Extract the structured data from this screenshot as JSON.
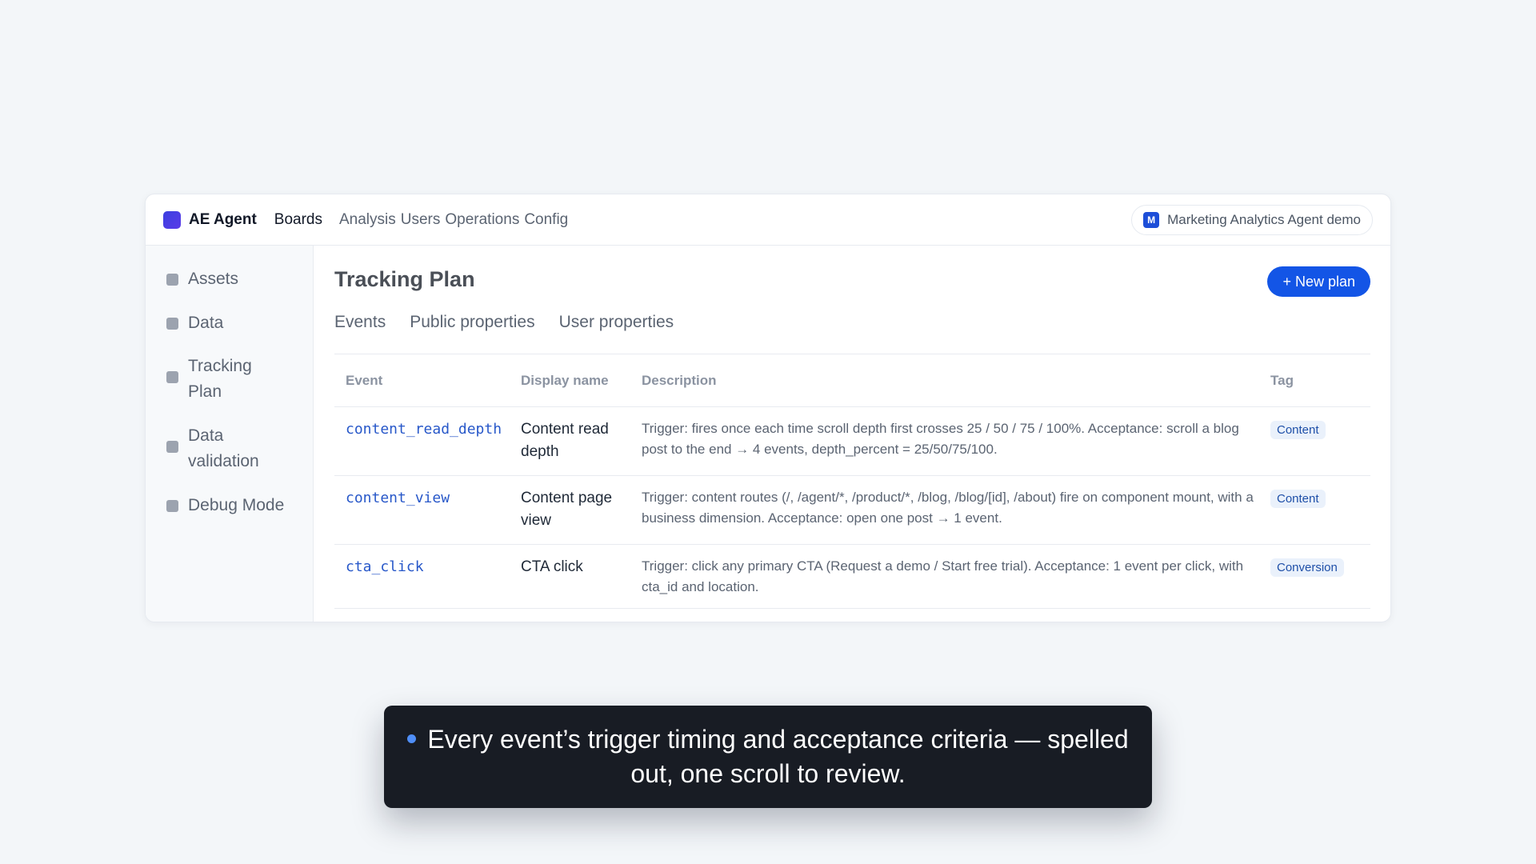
{
  "topbar": {
    "brand": "AE Agent",
    "nav_boards": "Boards",
    "nav_links": [
      "Analysis",
      "Users",
      "Operations",
      "Config"
    ],
    "workspace_badge": "M",
    "workspace_name": "Marketing Analytics Agent demo"
  },
  "sidebar": {
    "items": [
      {
        "label": "Assets"
      },
      {
        "label": "Data"
      },
      {
        "label": "Tracking Plan"
      },
      {
        "label": "Data validation"
      },
      {
        "label": "Debug Mode"
      }
    ]
  },
  "main": {
    "title": "Tracking Plan",
    "new_plan_label": "+ New plan",
    "tabs": [
      "Events",
      "Public properties",
      "User properties"
    ],
    "columns": [
      "Event",
      "Display name",
      "Description",
      "Tag"
    ],
    "rows": [
      {
        "event": "content_read_depth",
        "display_name": "Content read depth",
        "description": "Trigger: fires once each time scroll depth first crosses 25 / 50 / 75 / 100%. Acceptance: scroll a blog post to the end → 4 events, depth_percent = 25/50/75/100.",
        "tag": "Content"
      },
      {
        "event": "content_view",
        "display_name": "Content page view",
        "description": "Trigger: content routes (/, /agent/*, /product/*, /blog, /blog/[id], /about) fire on component mount, with a business dimension. Acceptance: open one post → 1 event.",
        "tag": "Content"
      },
      {
        "event": "cta_click",
        "display_name": "CTA click",
        "description": "Trigger: click any primary CTA (Request a demo / Start free trial). Acceptance: 1 event per click, with cta_id and location.",
        "tag": "Conversion"
      }
    ]
  },
  "caption": {
    "text": "Every event’s trigger timing and acceptance criteria — spelled out, one scroll to review."
  },
  "colors": {
    "accent": "#1355e6",
    "caption_bg": "#181c24",
    "tag_bg": "#eaf1fb"
  }
}
